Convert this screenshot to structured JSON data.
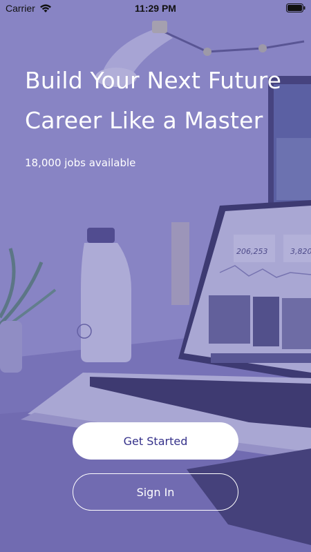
{
  "status_bar": {
    "carrier": "Carrier",
    "time": "11:29 PM",
    "icons": [
      "wifi-icon",
      "battery-icon"
    ]
  },
  "hero": {
    "title": "Build Your Next Future Career Like a Master",
    "subtitle": "18,000 jobs available"
  },
  "actions": {
    "get_started_label": "Get Started",
    "sign_in_label": "Sign In"
  },
  "background": {
    "screen_stats": [
      "206,253",
      "3,820"
    ]
  },
  "colors": {
    "overlay": "#5852a8",
    "primary_text": "#35318a",
    "button_bg": "#ffffff"
  }
}
